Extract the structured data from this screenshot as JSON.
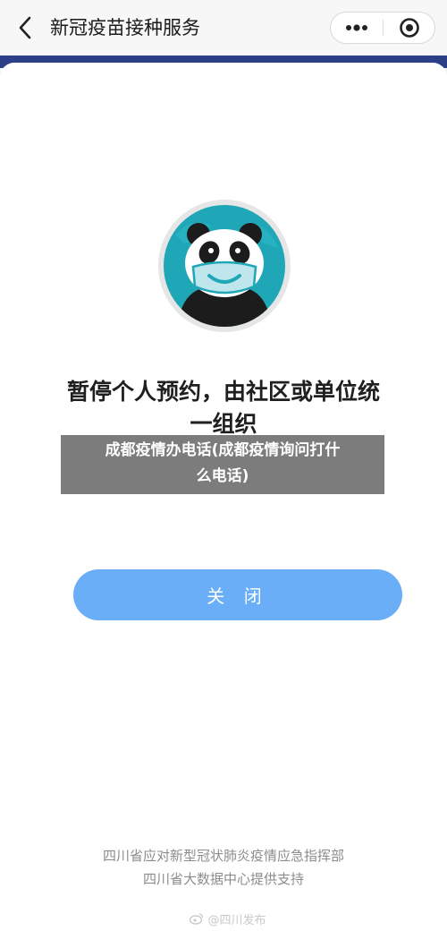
{
  "navbar": {
    "title": "新冠疫苗接种服务",
    "back_icon": "chevron-left-icon",
    "more_icon": "more-dots-icon",
    "target_icon": "close-miniapp-icon"
  },
  "colors": {
    "strip": "#2d3f86",
    "button": "#6aaef7",
    "logo_teal": "#1fa7b8"
  },
  "notice": {
    "logo_icon": "panda-mask-icon",
    "headline_line1": "暂停个人预约，由社区或单位统",
    "headline_line2": "一组织"
  },
  "overlay": {
    "line1": "成都疫情办电话(成都疫情询问打什",
    "line2": "么电话)"
  },
  "button": {
    "close_label": "关 闭"
  },
  "footer": {
    "line1": "四川省应对新型冠状肺炎疫情应急指挥部",
    "line2": "四川省大数据中心提供支持"
  },
  "watermark": {
    "icon": "weibo-icon",
    "text": "@四川发布"
  }
}
